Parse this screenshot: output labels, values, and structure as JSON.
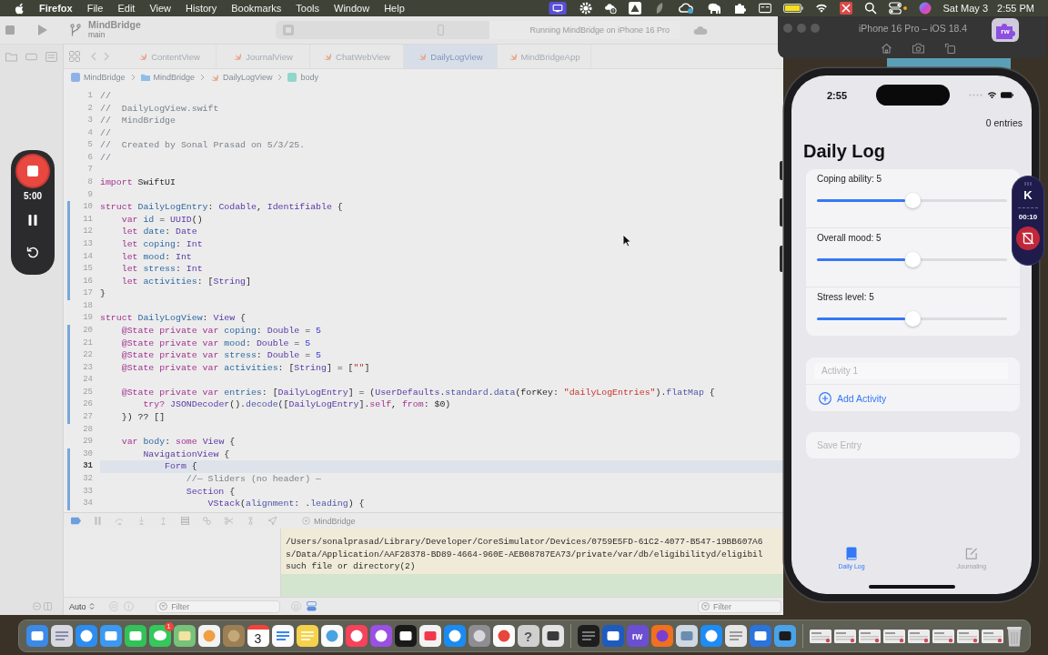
{
  "menu_bar": {
    "app_name": "Firefox",
    "menus": [
      "File",
      "Edit",
      "View",
      "History",
      "Bookmarks",
      "Tools",
      "Window",
      "Help"
    ],
    "date": "Sat May 3",
    "time": "2:55 PM"
  },
  "xcode": {
    "project": "MindBridge",
    "branch": "main",
    "status": "Running MindBridge on iPhone 16 Pro",
    "tabs": [
      {
        "label": "ContentView",
        "selected": false
      },
      {
        "label": "JournalView",
        "selected": false
      },
      {
        "label": "ChatWebView",
        "selected": false
      },
      {
        "label": "DailyLogView",
        "selected": true
      },
      {
        "label": "MindBridgeApp",
        "selected": false
      }
    ],
    "breadcrumb": [
      {
        "label": "MindBridge",
        "kind": "project"
      },
      {
        "label": "MindBridge",
        "kind": "folder"
      },
      {
        "label": "DailyLogView",
        "kind": "swift"
      },
      {
        "label": "body",
        "kind": "property"
      }
    ],
    "code_lines": [
      {
        "number": "1",
        "changed": false,
        "current": false,
        "tokens": [
          {
            "kind": "comment",
            "text": "//"
          }
        ]
      },
      {
        "number": "2",
        "changed": false,
        "current": false,
        "tokens": [
          {
            "kind": "comment",
            "text": "//  DailyLogView.swift"
          }
        ]
      },
      {
        "number": "3",
        "changed": false,
        "current": false,
        "tokens": [
          {
            "kind": "comment",
            "text": "//  MindBridge"
          }
        ]
      },
      {
        "number": "4",
        "changed": false,
        "current": false,
        "tokens": [
          {
            "kind": "comment",
            "text": "//"
          }
        ]
      },
      {
        "number": "5",
        "changed": false,
        "current": false,
        "tokens": [
          {
            "kind": "comment",
            "text": "//  Created by Sonal Prasad on 5/3/25."
          }
        ]
      },
      {
        "number": "6",
        "changed": false,
        "current": false,
        "tokens": [
          {
            "kind": "comment",
            "text": "//"
          }
        ]
      },
      {
        "number": "7",
        "changed": false,
        "current": false
      },
      {
        "number": "8",
        "changed": false,
        "current": false,
        "tokens": [
          {
            "kind": "keyword",
            "text": "import"
          },
          {
            "kind": "plain",
            "text": " SwiftUI"
          }
        ]
      },
      {
        "number": "9",
        "changed": false,
        "current": false
      },
      {
        "number": "10",
        "changed": true,
        "current": false,
        "tokens": [
          {
            "kind": "keyword",
            "text": "struct"
          },
          {
            "kind": "decl",
            "text": " DailyLogEntry"
          },
          {
            "kind": "plain",
            "text": ": "
          },
          {
            "kind": "type",
            "text": "Codable"
          },
          {
            "kind": "plain",
            "text": ", "
          },
          {
            "kind": "type",
            "text": "Identifiable"
          },
          {
            "kind": "plain",
            "text": " {"
          }
        ]
      },
      {
        "number": "11",
        "changed": true,
        "current": false,
        "tokens": [
          {
            "kind": "keyword",
            "text": "    var"
          },
          {
            "kind": "decl",
            "text": " id"
          },
          {
            "kind": "plain",
            "text": " = "
          },
          {
            "kind": "type",
            "text": "UUID"
          },
          {
            "kind": "plain",
            "text": "()"
          }
        ]
      },
      {
        "number": "12",
        "changed": true,
        "current": false,
        "tokens": [
          {
            "kind": "keyword",
            "text": "    let"
          },
          {
            "kind": "decl",
            "text": " date"
          },
          {
            "kind": "plain",
            "text": ": "
          },
          {
            "kind": "type",
            "text": "Date"
          }
        ]
      },
      {
        "number": "13",
        "changed": true,
        "current": false,
        "tokens": [
          {
            "kind": "keyword",
            "text": "    let"
          },
          {
            "kind": "decl",
            "text": " coping"
          },
          {
            "kind": "plain",
            "text": ": "
          },
          {
            "kind": "type",
            "text": "Int"
          }
        ]
      },
      {
        "number": "14",
        "changed": true,
        "current": false,
        "tokens": [
          {
            "kind": "keyword",
            "text": "    let"
          },
          {
            "kind": "decl",
            "text": " mood"
          },
          {
            "kind": "plain",
            "text": ": "
          },
          {
            "kind": "type",
            "text": "Int"
          }
        ]
      },
      {
        "number": "15",
        "changed": true,
        "current": false,
        "tokens": [
          {
            "kind": "keyword",
            "text": "    let"
          },
          {
            "kind": "decl",
            "text": " stress"
          },
          {
            "kind": "plain",
            "text": ": "
          },
          {
            "kind": "type",
            "text": "Int"
          }
        ]
      },
      {
        "number": "16",
        "changed": true,
        "current": false,
        "tokens": [
          {
            "kind": "keyword",
            "text": "    let"
          },
          {
            "kind": "decl",
            "text": " activities"
          },
          {
            "kind": "plain",
            "text": ": ["
          },
          {
            "kind": "type",
            "text": "String"
          },
          {
            "kind": "plain",
            "text": "]"
          }
        ]
      },
      {
        "number": "17",
        "changed": true,
        "current": false,
        "tokens": [
          {
            "kind": "plain",
            "text": "}"
          }
        ]
      },
      {
        "number": "18",
        "changed": false,
        "current": false
      },
      {
        "number": "19",
        "changed": false,
        "current": false,
        "tokens": [
          {
            "kind": "keyword",
            "text": "struct"
          },
          {
            "kind": "decl",
            "text": " DailyLogView"
          },
          {
            "kind": "plain",
            "text": ": "
          },
          {
            "kind": "type",
            "text": "View"
          },
          {
            "kind": "plain",
            "text": " {"
          }
        ]
      },
      {
        "number": "20",
        "changed": true,
        "current": false,
        "tokens": [
          {
            "kind": "keyword",
            "text": "    @State private var"
          },
          {
            "kind": "decl",
            "text": " coping"
          },
          {
            "kind": "plain",
            "text": ": "
          },
          {
            "kind": "type",
            "text": "Double"
          },
          {
            "kind": "plain",
            "text": " = "
          },
          {
            "kind": "number",
            "text": "5"
          }
        ]
      },
      {
        "number": "21",
        "changed": true,
        "current": false,
        "tokens": [
          {
            "kind": "keyword",
            "text": "    @State private var"
          },
          {
            "kind": "decl",
            "text": " mood"
          },
          {
            "kind": "plain",
            "text": ": "
          },
          {
            "kind": "type",
            "text": "Double"
          },
          {
            "kind": "plain",
            "text": " = "
          },
          {
            "kind": "number",
            "text": "5"
          }
        ]
      },
      {
        "number": "22",
        "changed": true,
        "current": false,
        "tokens": [
          {
            "kind": "keyword",
            "text": "    @State private var"
          },
          {
            "kind": "decl",
            "text": " stress"
          },
          {
            "kind": "plain",
            "text": ": "
          },
          {
            "kind": "type",
            "text": "Double"
          },
          {
            "kind": "plain",
            "text": " = "
          },
          {
            "kind": "number",
            "text": "5"
          }
        ]
      },
      {
        "number": "23",
        "changed": true,
        "current": false,
        "tokens": [
          {
            "kind": "keyword",
            "text": "    @State private var"
          },
          {
            "kind": "decl",
            "text": " activities"
          },
          {
            "kind": "plain",
            "text": ": ["
          },
          {
            "kind": "type",
            "text": "String"
          },
          {
            "kind": "plain",
            "text": "] = ["
          },
          {
            "kind": "string",
            "text": "\"\""
          },
          {
            "kind": "plain",
            "text": "]"
          }
        ]
      },
      {
        "number": "24",
        "changed": true,
        "current": false
      },
      {
        "number": "25",
        "changed": true,
        "current": false,
        "tokens": [
          {
            "kind": "keyword",
            "text": "    @State private var"
          },
          {
            "kind": "decl",
            "text": " entries"
          },
          {
            "kind": "plain",
            "text": ": ["
          },
          {
            "kind": "type",
            "text": "DailyLogEntry"
          },
          {
            "kind": "plain",
            "text": "] = ("
          },
          {
            "kind": "type",
            "text": "UserDefaults"
          },
          {
            "kind": "plain",
            "text": "."
          },
          {
            "kind": "member",
            "text": "standard"
          },
          {
            "kind": "plain",
            "text": "."
          },
          {
            "kind": "member",
            "text": "data"
          },
          {
            "kind": "plain",
            "text": "(forKey: "
          },
          {
            "kind": "string",
            "text": "\"dailyLogEntries\""
          },
          {
            "kind": "plain",
            "text": ")."
          },
          {
            "kind": "member",
            "text": "flatMap"
          },
          {
            "kind": "plain",
            "text": " {"
          }
        ]
      },
      {
        "number": "26",
        "changed": true,
        "current": false,
        "tokens": [
          {
            "kind": "keyword",
            "text": "        try?"
          },
          {
            "kind": "type",
            "text": " JSONDecoder"
          },
          {
            "kind": "plain",
            "text": "()."
          },
          {
            "kind": "member",
            "text": "decode"
          },
          {
            "kind": "plain",
            "text": "(["
          },
          {
            "kind": "type",
            "text": "DailyLogEntry"
          },
          {
            "kind": "plain",
            "text": "]."
          },
          {
            "kind": "keyword",
            "text": "self"
          },
          {
            "kind": "plain",
            "text": ", "
          },
          {
            "kind": "keyword",
            "text": "from"
          },
          {
            "kind": "plain",
            "text": ": $0)"
          }
        ]
      },
      {
        "number": "27",
        "changed": true,
        "current": false,
        "tokens": [
          {
            "kind": "plain",
            "text": "    }) ?? []"
          }
        ]
      },
      {
        "number": "28",
        "changed": false,
        "current": false
      },
      {
        "number": "29",
        "changed": false,
        "current": false,
        "tokens": [
          {
            "kind": "keyword",
            "text": "    var"
          },
          {
            "kind": "decl",
            "text": " body"
          },
          {
            "kind": "plain",
            "text": ": "
          },
          {
            "kind": "keyword",
            "text": "some"
          },
          {
            "kind": "type",
            "text": " View"
          },
          {
            "kind": "plain",
            "text": " {"
          }
        ]
      },
      {
        "number": "30",
        "changed": true,
        "current": false,
        "tokens": [
          {
            "kind": "type",
            "text": "        NavigationView"
          },
          {
            "kind": "plain",
            "text": " {"
          }
        ]
      },
      {
        "number": "31",
        "changed": true,
        "current": true,
        "tokens": [
          {
            "kind": "type",
            "text": "            Form"
          },
          {
            "kind": "plain",
            "text": " {"
          }
        ]
      },
      {
        "number": "32",
        "changed": true,
        "current": false,
        "tokens": [
          {
            "kind": "comment",
            "text": "                //— Sliders (no header) —"
          }
        ]
      },
      {
        "number": "33",
        "changed": true,
        "current": false,
        "tokens": [
          {
            "kind": "type",
            "text": "                Section"
          },
          {
            "kind": "plain",
            "text": " {"
          }
        ]
      },
      {
        "number": "34",
        "changed": true,
        "current": false,
        "tokens": [
          {
            "kind": "type",
            "text": "                    VStack"
          },
          {
            "kind": "plain",
            "text": "("
          },
          {
            "kind": "member",
            "text": "alignment"
          },
          {
            "kind": "plain",
            "text": ": ."
          },
          {
            "kind": "member",
            "text": "leading"
          },
          {
            "kind": "plain",
            "text": ") {"
          }
        ]
      }
    ],
    "debug_target": "MindBridge",
    "console_lines": [
      "/Users/sonalprasad/Library/Developer/CoreSimulator/Devices/0759E5FD-61C2-4077-B547-19BB607A6",
      "s/Data/Application/AAF28378-BD89-4664-960E-AEB08787EA73/private/var/db/eligibilityd/eligibil",
      "such file or directory(2)"
    ],
    "variables_scope": "Auto",
    "variables_filter": {
      "placeholder": "Filter"
    },
    "console_filter": {
      "placeholder": "Filter"
    }
  },
  "recorder_widget": {
    "time": "5:00"
  },
  "simulator": {
    "title": "iPhone 16 Pro – iOS 18.4",
    "status_time": "2:55",
    "entry_count": "0 entries",
    "heading": "Daily Log",
    "sliders": [
      {
        "label": "Coping ability: 5",
        "level": 0.5
      },
      {
        "label": "Overall mood: 5",
        "level": 0.5
      },
      {
        "label": "Stress level: 5",
        "level": 0.5
      }
    ],
    "activity_field": {
      "placeholder": "Activity 1"
    },
    "add_button": "Add Activity",
    "save_button": {
      "label": "Save Entry",
      "disabled": true
    },
    "tab_bar": [
      {
        "label": "Daily Log",
        "kind": "book",
        "selected": true
      },
      {
        "label": "Journaling",
        "kind": "compose",
        "selected": false
      }
    ]
  },
  "extension_button": {
    "label": "rw"
  },
  "floating_recorder": {
    "logo": "K",
    "elapsed": "00:10"
  },
  "dock": {
    "messages_badge": "1",
    "calendar_day": "3",
    "help_glyph": "?",
    "rw_label": "rw"
  }
}
